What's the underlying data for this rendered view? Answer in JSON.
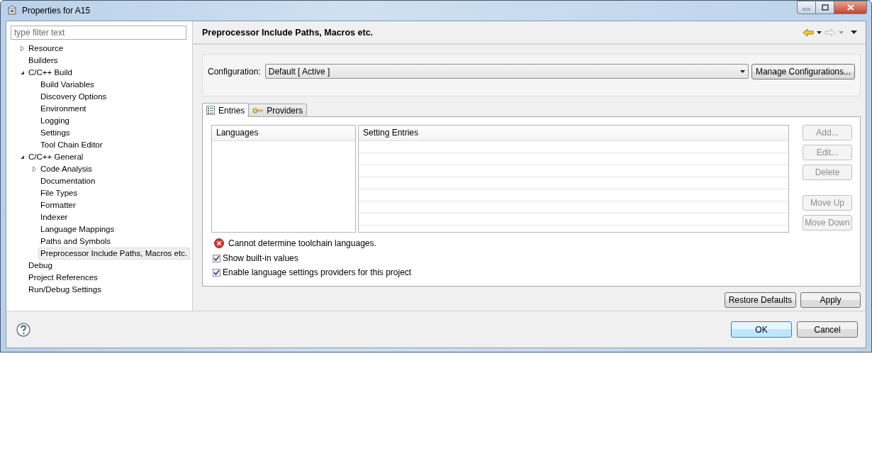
{
  "window": {
    "title": "Properties for A15"
  },
  "filter": {
    "placeholder": "type filter text"
  },
  "tree": [
    {
      "label": "Resource",
      "kind": "folder",
      "expanded": false,
      "selected": false
    },
    {
      "label": "Builders",
      "kind": "leaf",
      "selected": false
    },
    {
      "label": "C/C++ Build",
      "kind": "folder",
      "expanded": true,
      "selected": false,
      "children": [
        {
          "label": "Build Variables",
          "kind": "leaf",
          "selected": false
        },
        {
          "label": "Discovery Options",
          "kind": "leaf",
          "selected": false
        },
        {
          "label": "Environment",
          "kind": "leaf",
          "selected": false
        },
        {
          "label": "Logging",
          "kind": "leaf",
          "selected": false
        },
        {
          "label": "Settings",
          "kind": "leaf",
          "selected": false
        },
        {
          "label": "Tool Chain Editor",
          "kind": "leaf",
          "selected": false
        }
      ]
    },
    {
      "label": "C/C++ General",
      "kind": "folder",
      "expanded": true,
      "selected": false,
      "children": [
        {
          "label": "Code Analysis",
          "kind": "folder",
          "expanded": false,
          "selected": false
        },
        {
          "label": "Documentation",
          "kind": "leaf",
          "selected": false
        },
        {
          "label": "File Types",
          "kind": "leaf",
          "selected": false
        },
        {
          "label": "Formatter",
          "kind": "leaf",
          "selected": false
        },
        {
          "label": "Indexer",
          "kind": "leaf",
          "selected": false
        },
        {
          "label": "Language Mappings",
          "kind": "leaf",
          "selected": false
        },
        {
          "label": "Paths and Symbols",
          "kind": "leaf",
          "selected": false
        },
        {
          "label": "Preprocessor Include Paths, Macros etc.",
          "kind": "leaf",
          "selected": true
        }
      ]
    },
    {
      "label": "Debug",
      "kind": "leaf",
      "selected": false
    },
    {
      "label": "Project References",
      "kind": "leaf",
      "selected": false
    },
    {
      "label": "Run/Debug Settings",
      "kind": "leaf",
      "selected": false
    }
  ],
  "page": {
    "title": "Preprocessor Include Paths, Macros etc.",
    "back_enabled": true,
    "forward_enabled": false,
    "configuration": {
      "label": "Configuration:",
      "value": "Default  [ Active ]",
      "button": "Manage Configurations..."
    },
    "tabs": [
      {
        "label": "Entries",
        "kind": "list",
        "selected": true
      },
      {
        "label": "Providers",
        "kind": "key",
        "selected": false
      }
    ],
    "languages_column": "Languages",
    "entries_column": "Setting Entries",
    "side_buttons": [
      {
        "label": "Add...",
        "disabled": true
      },
      {
        "label": "Edit...",
        "disabled": true
      },
      {
        "label": "Delete",
        "disabled": true
      },
      {
        "label": "Move Up",
        "disabled": true,
        "gap_before": true
      },
      {
        "label": "Move Down",
        "disabled": true
      }
    ],
    "error": "Cannot determine toolchain languages.",
    "checkboxes": [
      {
        "label": "Show built-in values",
        "checked": true
      },
      {
        "label": "Enable language settings providers for this project",
        "checked": true
      }
    ],
    "buttons": [
      "Restore Defaults",
      "Apply"
    ]
  },
  "footer": {
    "buttons": [
      {
        "label": "OK",
        "default": true
      },
      {
        "label": "Cancel",
        "default": false
      }
    ]
  }
}
